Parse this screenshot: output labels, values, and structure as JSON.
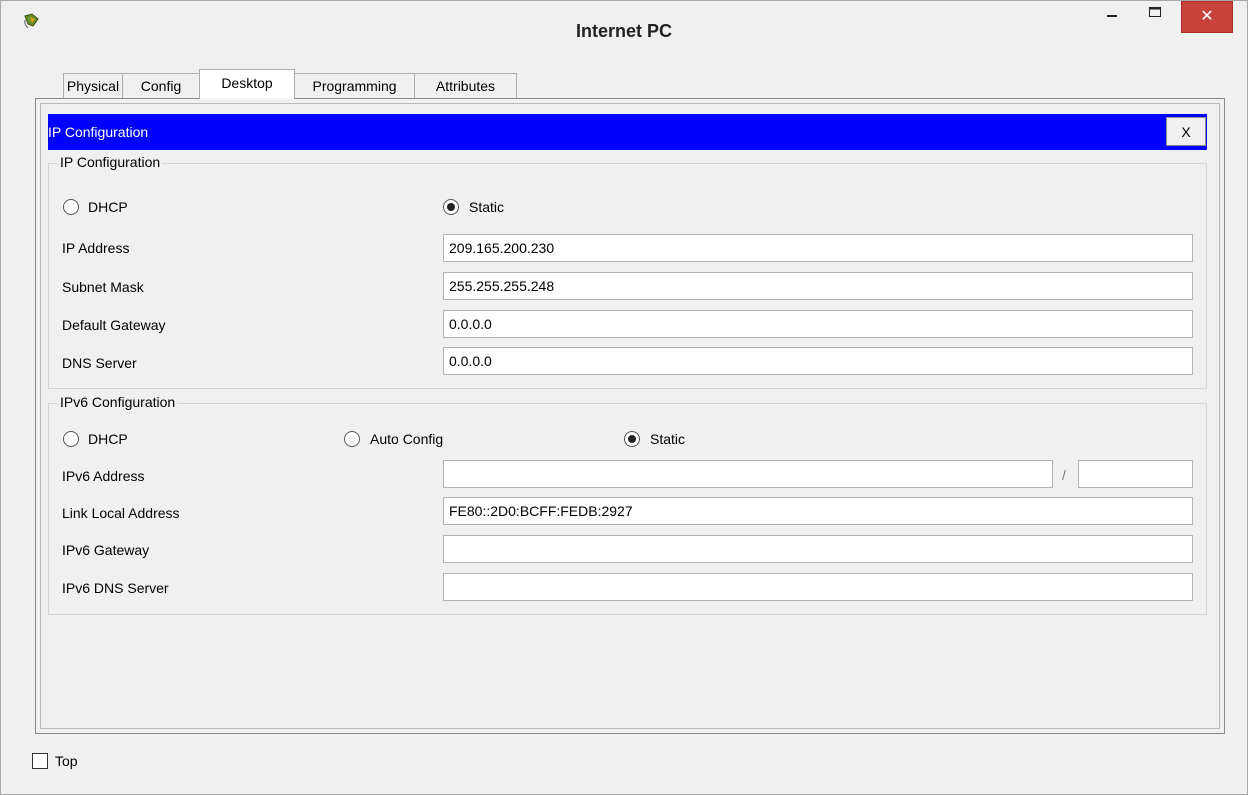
{
  "window": {
    "title": "Internet PC",
    "close_label": "✕"
  },
  "tabs": [
    {
      "label": "Physical"
    },
    {
      "label": "Config"
    },
    {
      "label": "Desktop"
    },
    {
      "label": "Programming"
    },
    {
      "label": "Attributes"
    }
  ],
  "active_tab": "Desktop",
  "ip_config_header": {
    "title": "IP Configuration",
    "close_label": "X"
  },
  "ipv4": {
    "legend": "IP Configuration",
    "dhcp_label": "DHCP",
    "static_label": "Static",
    "selected_mode": "Static",
    "ip_address_label": "IP Address",
    "ip_address": "209.165.200.230",
    "subnet_mask_label": "Subnet Mask",
    "subnet_mask": "255.255.255.248",
    "default_gateway_label": "Default Gateway",
    "default_gateway": "0.0.0.0",
    "dns_server_label": "DNS Server",
    "dns_server": "0.0.0.0"
  },
  "ipv6": {
    "legend": "IPv6 Configuration",
    "dhcp_label": "DHCP",
    "auto_config_label": "Auto Config",
    "static_label": "Static",
    "selected_mode": "Static",
    "address_label": "IPv6 Address",
    "address": "",
    "prefix_separator": "/",
    "prefix": "",
    "link_local_label": "Link Local Address",
    "link_local": "FE80::2D0:BCFF:FEDB:2927",
    "gateway_label": "IPv6 Gateway",
    "gateway": "",
    "dns_label": "IPv6 DNS Server",
    "dns": ""
  },
  "footer": {
    "top_label": "Top",
    "top_checked": false
  },
  "colors": {
    "header_blue": "#0000ff",
    "close_red": "#c9413b"
  }
}
